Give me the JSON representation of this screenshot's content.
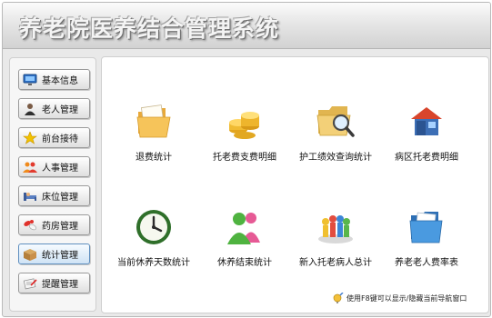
{
  "app_title": "养老院医养结合管理系统",
  "sidebar": {
    "items": [
      {
        "label": "基本信息",
        "icon": "monitor-icon"
      },
      {
        "label": "老人管理",
        "icon": "person-icon"
      },
      {
        "label": "前台接待",
        "icon": "star-icon"
      },
      {
        "label": "人事管理",
        "icon": "users-icon"
      },
      {
        "label": "床位管理",
        "icon": "bed-icon"
      },
      {
        "label": "药房管理",
        "icon": "pills-icon"
      },
      {
        "label": "统计管理",
        "icon": "box-icon",
        "active": true
      },
      {
        "label": "提醒管理",
        "icon": "reminder-icon"
      }
    ]
  },
  "tiles": [
    {
      "label": "退费统计",
      "icon": "folder-icon"
    },
    {
      "label": "托老费支费明细",
      "icon": "coins-icon"
    },
    {
      "label": "护工绩效查询统计",
      "icon": "folder-search-icon"
    },
    {
      "label": "病区托老费明细",
      "icon": "house-icon"
    },
    {
      "label": "当前休养天数统计",
      "icon": "clock-icon"
    },
    {
      "label": "休养结束统计",
      "icon": "people-icon"
    },
    {
      "label": "新入托老病人总计",
      "icon": "group-icon"
    },
    {
      "label": "养老老人费率表",
      "icon": "blue-folder-icon"
    }
  ],
  "status_hint": "使用F8键可以显示/隐藏当前导航窗口"
}
